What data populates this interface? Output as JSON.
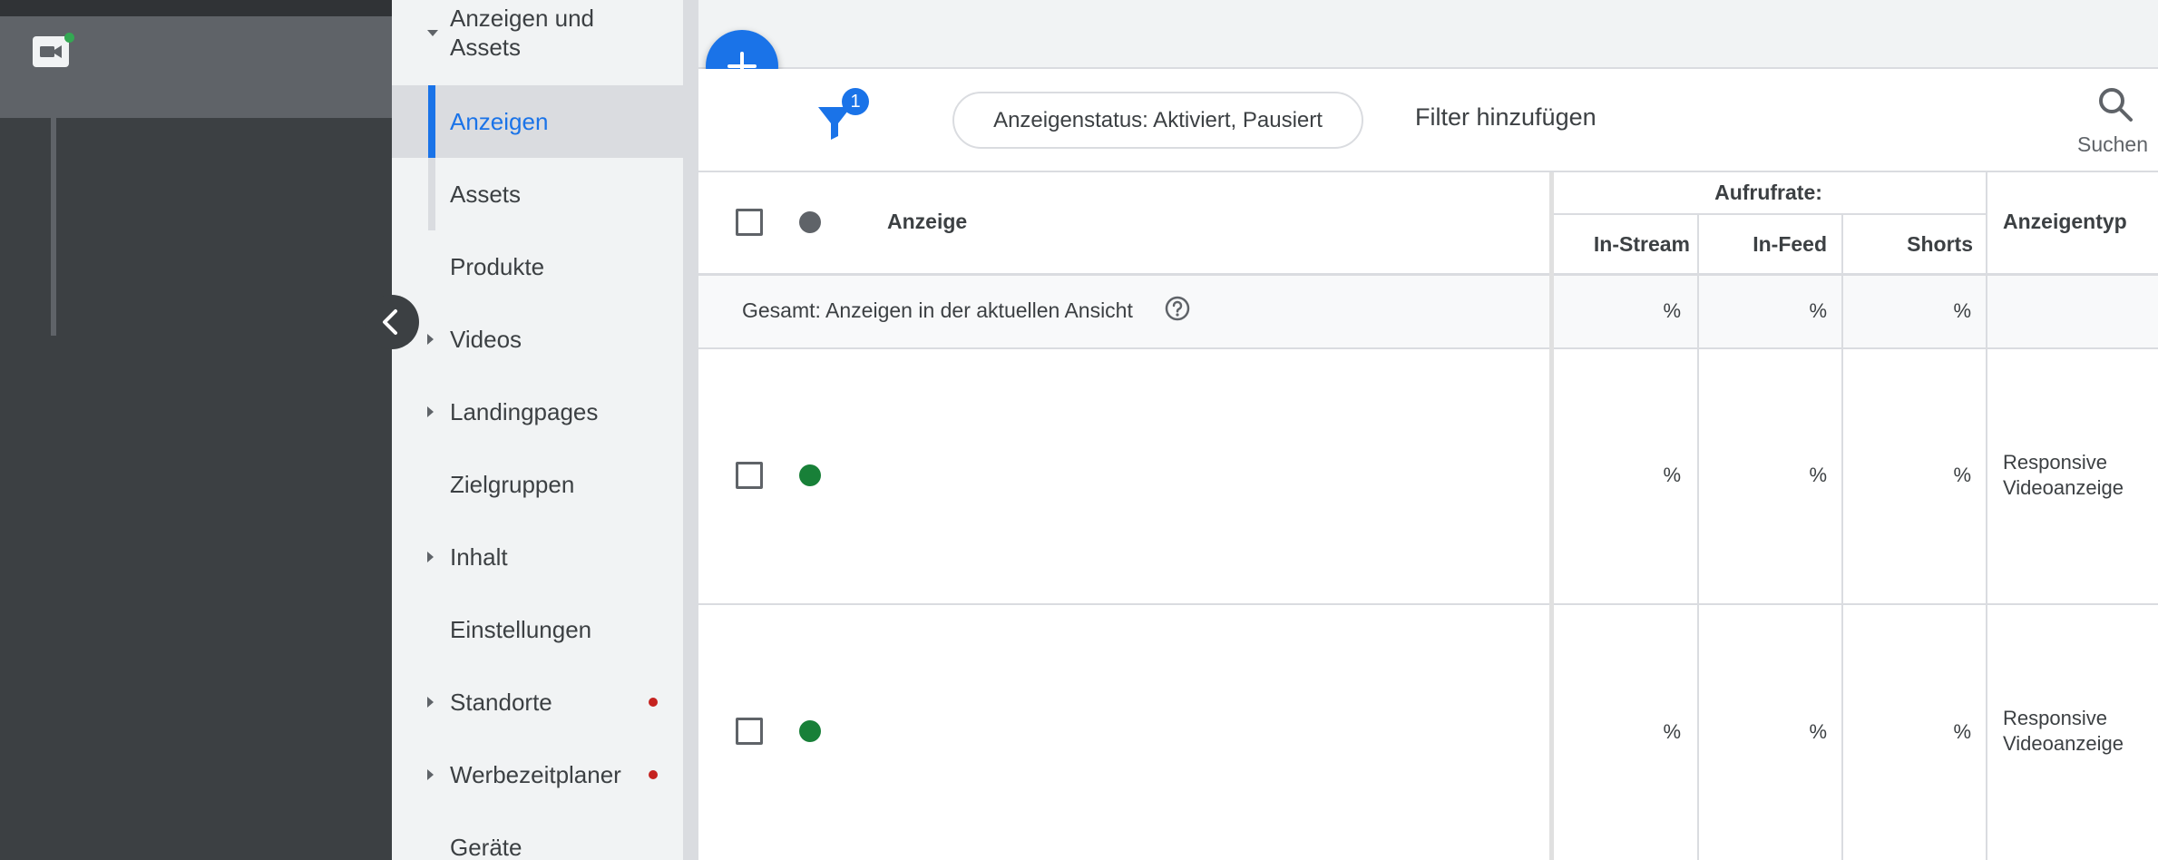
{
  "nav": {
    "items": [
      {
        "label_line1": "Anzeigen und",
        "label_line2": "Assets",
        "expanded": true
      },
      {
        "label": "Anzeigen",
        "selected": true
      },
      {
        "label": "Assets"
      },
      {
        "label": "Produkte"
      },
      {
        "label": "Videos",
        "expandable": true
      },
      {
        "label": "Landingpages",
        "expandable": true
      },
      {
        "label": "Zielgruppen"
      },
      {
        "label": "Inhalt",
        "expandable": true
      },
      {
        "label": "Einstellungen"
      },
      {
        "label": "Standorte",
        "expandable": true,
        "alert": true
      },
      {
        "label": "Werbezeitplaner",
        "expandable": true,
        "alert": true
      },
      {
        "label": "Geräte"
      }
    ]
  },
  "toolbar": {
    "filter_count": "1",
    "status_chip": "Anzeigenstatus: Aktiviert, Pausiert",
    "add_filter": "Filter hinzufügen",
    "search_label": "Suchen"
  },
  "table": {
    "header": {
      "ad": "Anzeige",
      "view_rate_group": "Aufrufrate:",
      "in_stream": "In-Stream",
      "in_feed": "In-Feed",
      "shorts": "Shorts",
      "ad_type": "Anzeigentyp"
    },
    "total_row": {
      "label": "Gesamt: Anzeigen in der aktuellen Ansicht",
      "in_stream": "%",
      "in_feed": "%",
      "shorts": "%"
    },
    "rows": [
      {
        "in_stream": "%",
        "in_feed": "%",
        "shorts": "%",
        "type_line1": "Responsive",
        "type_line2": "Videoanzeige",
        "status_color": "#188038"
      },
      {
        "in_stream": "%",
        "in_feed": "%",
        "shorts": "%",
        "type_line1": "Responsive",
        "type_line2": "Videoanzeige",
        "status_color": "#188038"
      }
    ]
  },
  "colors": {
    "accent": "#1a73e8",
    "status_enabled": "#188038",
    "alert": "#c5221f"
  }
}
